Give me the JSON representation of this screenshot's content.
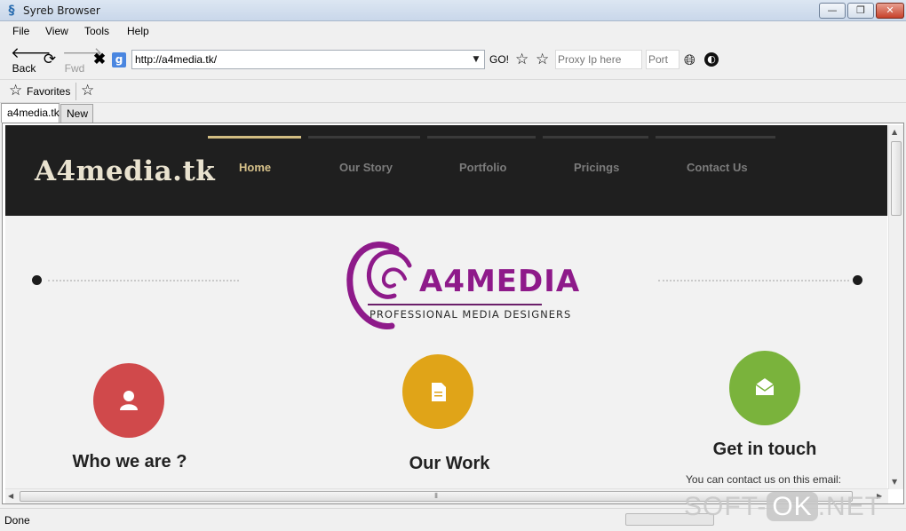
{
  "window": {
    "title": "Syreb Browser",
    "minimize": "—",
    "maximize": "❐",
    "close": "✕"
  },
  "menu": {
    "items": [
      "File",
      "View",
      "Tools",
      "Help"
    ]
  },
  "toolbar": {
    "back_label": "Back",
    "forward_label": "Fwd",
    "address_value": "http://a4media.tk/",
    "go_label": "GO!",
    "proxy_placeholder": "Proxy Ip here",
    "port_placeholder": "Port"
  },
  "favorites": {
    "label": "Favorites"
  },
  "tabs": [
    {
      "label": "a4media.tk",
      "active": true
    },
    {
      "label": "New",
      "active": false
    }
  ],
  "site": {
    "logo_text": "A4media.tk",
    "nav": [
      "Home",
      "Our Story",
      "Portfolio",
      "Pricings",
      "Contact Us"
    ],
    "brand_name": "A4MEDIA",
    "brand_tagline": "PROFESSIONAL MEDIA DESIGNERS",
    "features": [
      {
        "title": "Who we are ?",
        "color": "#d0494b",
        "icon": "user-icon"
      },
      {
        "title": "Our Work",
        "color": "#e0a418",
        "icon": "document-icon"
      },
      {
        "title": "Get in touch",
        "color": "#7ab33c",
        "icon": "mail-icon"
      }
    ],
    "contact_text": "You can contact us on this email:"
  },
  "status": {
    "text": "Done"
  },
  "watermark": {
    "text_left": "SOFT-",
    "text_ok": "OK",
    "text_right": ".NET"
  },
  "colors": {
    "header_bg": "#1f1f1f",
    "nav_active": "#d6c18a",
    "brand_purple": "#8e1a8a"
  }
}
